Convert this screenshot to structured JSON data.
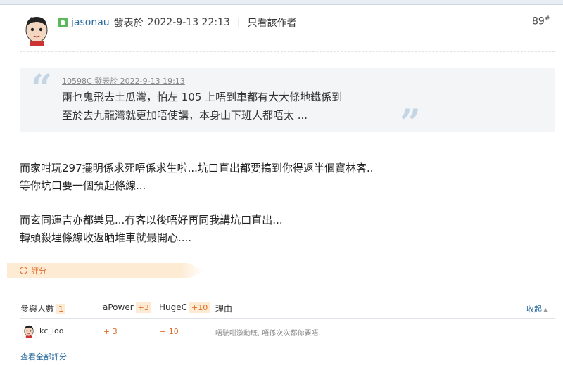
{
  "post": {
    "author": "jasonau",
    "posted_prefix": "發表於",
    "posted_at": "2022-9-13 22:13",
    "separator": "|",
    "only_author_label": "只看該作者",
    "floor_number": "89",
    "floor_suffix": "#"
  },
  "quote": {
    "meta": "10598C 發表於 2022-9-13 19:13",
    "lines": [
      "兩乜鬼飛去土瓜灣，怕左 105 上唔到車都有大大條地鐵係到",
      "至於去九龍灣就更加唔使講，本身山下班人都唔太 ..."
    ]
  },
  "message": {
    "lines": [
      "而家咁玩297擺明係求死唔係求生啦...坑口直出都要搞到你得返半個寶林客..",
      "等你坑口要一個預起條線...",
      "而玄同運吉亦都樂見...冇客以後唔好再同我講坑口直出...",
      "轉頭殺埋條線收返晒堆車就最開心...."
    ]
  },
  "rating": {
    "section_label": "評分",
    "participants_label": "參與人數",
    "participants_count": "1",
    "apower_label": "aPower",
    "apower_total": "+3",
    "hugec_label": "HugeC",
    "hugec_total": "+10",
    "reason_label": "理由",
    "collapse_label": "收起",
    "rows": [
      {
        "user": "kc_loo",
        "apower": "+ 3",
        "hugec": "+ 10",
        "reason": "唔駛咁激動既, 唔係次次都你要唔."
      }
    ],
    "view_all_label": "查看全部評分"
  },
  "colors": {
    "link": "#2a6aa0",
    "accent_orange": "#e06b2b",
    "badge_bg": "#fdebd3",
    "quote_bg": "#f4f5f7",
    "online_green": "#5cb85c"
  },
  "icons": [
    "avatar",
    "online-status-icon",
    "quote-open-icon",
    "quote-close-icon",
    "rating-circle-icon",
    "chevron-up-icon"
  ]
}
